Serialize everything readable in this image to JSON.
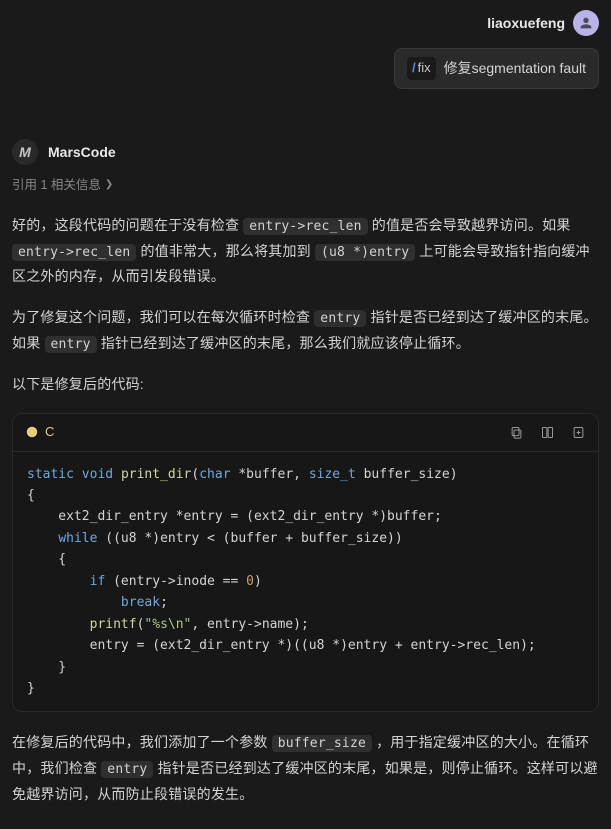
{
  "user": {
    "name": "liaoxuefeng",
    "message_prefix_badge": "fix",
    "message": "修复segmentation fault"
  },
  "assistant": {
    "name": "MarsCode",
    "avatar_glyph": "M",
    "ref_text": "引用 1 相关信息",
    "p1_a": "好的，这段代码的问题在于没有检查 ",
    "p1_code1": "entry->rec_len",
    "p1_b": " 的值是否会导致越界访问。如果 ",
    "p1_code2": "entry->rec_len",
    "p1_c": " 的值非常大，那么将其加到 ",
    "p1_code3": "(u8 *)entry",
    "p1_d": " 上可能会导致指针指向缓冲区之外的内存，从而引发段错误。",
    "p2_a": "为了修复这个问题，我们可以在每次循环时检查 ",
    "p2_code1": "entry",
    "p2_b": " 指针是否已经到达了缓冲区的末尾。如果 ",
    "p2_code2": "entry",
    "p2_c": " 指针已经到达了缓冲区的末尾，那么我们就应该停止循环。",
    "p3": "以下是修复后的代码:",
    "p4_a": "在修复后的代码中，我们添加了一个参数 ",
    "p4_code1": "buffer_size",
    "p4_b": " ，用于指定缓冲区的大小。在循环中，我们检查 ",
    "p4_code2": "entry",
    "p4_c": " 指针是否已经到达了缓冲区的末尾，如果是，则停止循环。这样可以避免越界访问，从而防止段错误的发生。"
  },
  "code": {
    "lang": "C"
  }
}
